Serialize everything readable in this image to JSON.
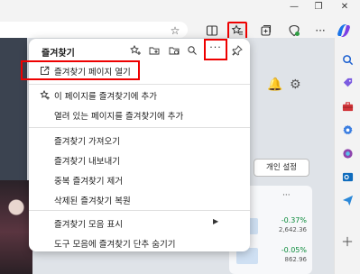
{
  "settings_pill": "개인 설정",
  "stocks": [
    {
      "change": "-0.37%",
      "value": "2,642.36"
    },
    {
      "change": "-0.05%",
      "value": "862.96"
    }
  ],
  "favorites": {
    "title": "즐겨찾기",
    "more_label": "···",
    "menu": [
      {
        "label": "즐겨찾기 페이지 열기",
        "icon": "open-external-icon",
        "highlighted": true
      },
      {
        "label": "이 페이지를 즐겨찾기에 추가",
        "icon": "star-add-icon"
      },
      {
        "label": "열려 있는 페이지를 즐겨찾기에 추가"
      },
      {
        "label": "즐겨찾기 가져오기"
      },
      {
        "label": "즐겨찾기 내보내기"
      },
      {
        "label": "중복 즐겨찾기 제거"
      },
      {
        "label": "삭제된 즐겨찾기 복원"
      },
      {
        "label": "즐겨찾기 모음 표시",
        "has_submenu": true
      },
      {
        "label": "도구 모음에 즐겨찾기 단추 숨기기"
      }
    ]
  },
  "colors": {
    "highlight": "#e00000",
    "panel_bg": "#ffffff",
    "stock_down": "#0a8a3a"
  }
}
